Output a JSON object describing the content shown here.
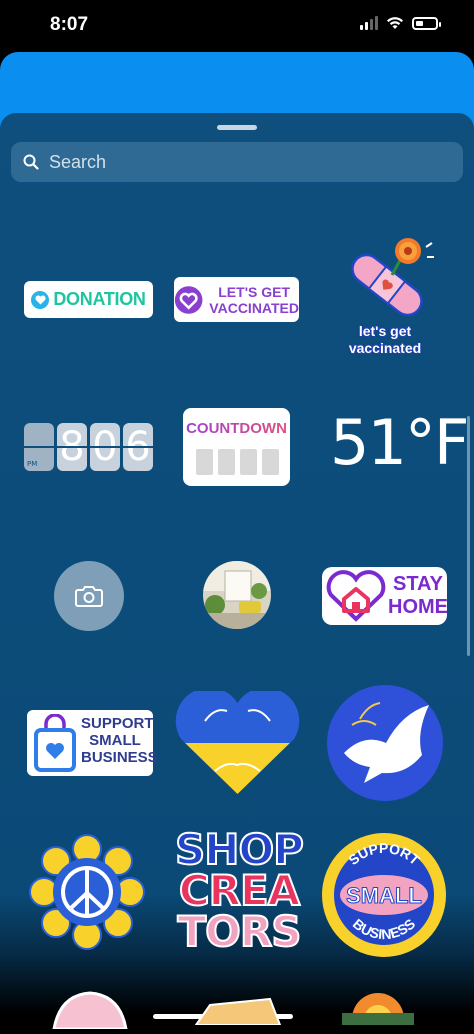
{
  "status_bar": {
    "time": "8:07"
  },
  "search": {
    "placeholder": "Search",
    "icon": "search-icon"
  },
  "stickers": {
    "donation": {
      "label": "DONATION"
    },
    "vaccinated_badge": {
      "label": "LET'S GET\nVACCINATED"
    },
    "vaccinated_bandage": {
      "label": "let's get\nvaccinated"
    },
    "clock": {
      "period": "PM",
      "digits": [
        "8",
        "0",
        "6"
      ]
    },
    "countdown": {
      "label": "COUNTDOWN"
    },
    "temperature": {
      "label": "51°F"
    },
    "stay_home": {
      "label": "STAY\nHOME"
    },
    "support_small_business": {
      "label": "SUPPORT\nSMALL\nBUSINESS"
    },
    "shop_creators": {
      "lines": [
        "SHOP",
        "CREA",
        "TORS"
      ]
    },
    "support_small_circle": {
      "top": "SUPPORT",
      "center": "SMALL",
      "bottom": "BUSINESS"
    }
  },
  "colors": {
    "sheet": "#0e4f7e",
    "story_background": "#0a8ff0",
    "search_field": "#2f6a94"
  }
}
